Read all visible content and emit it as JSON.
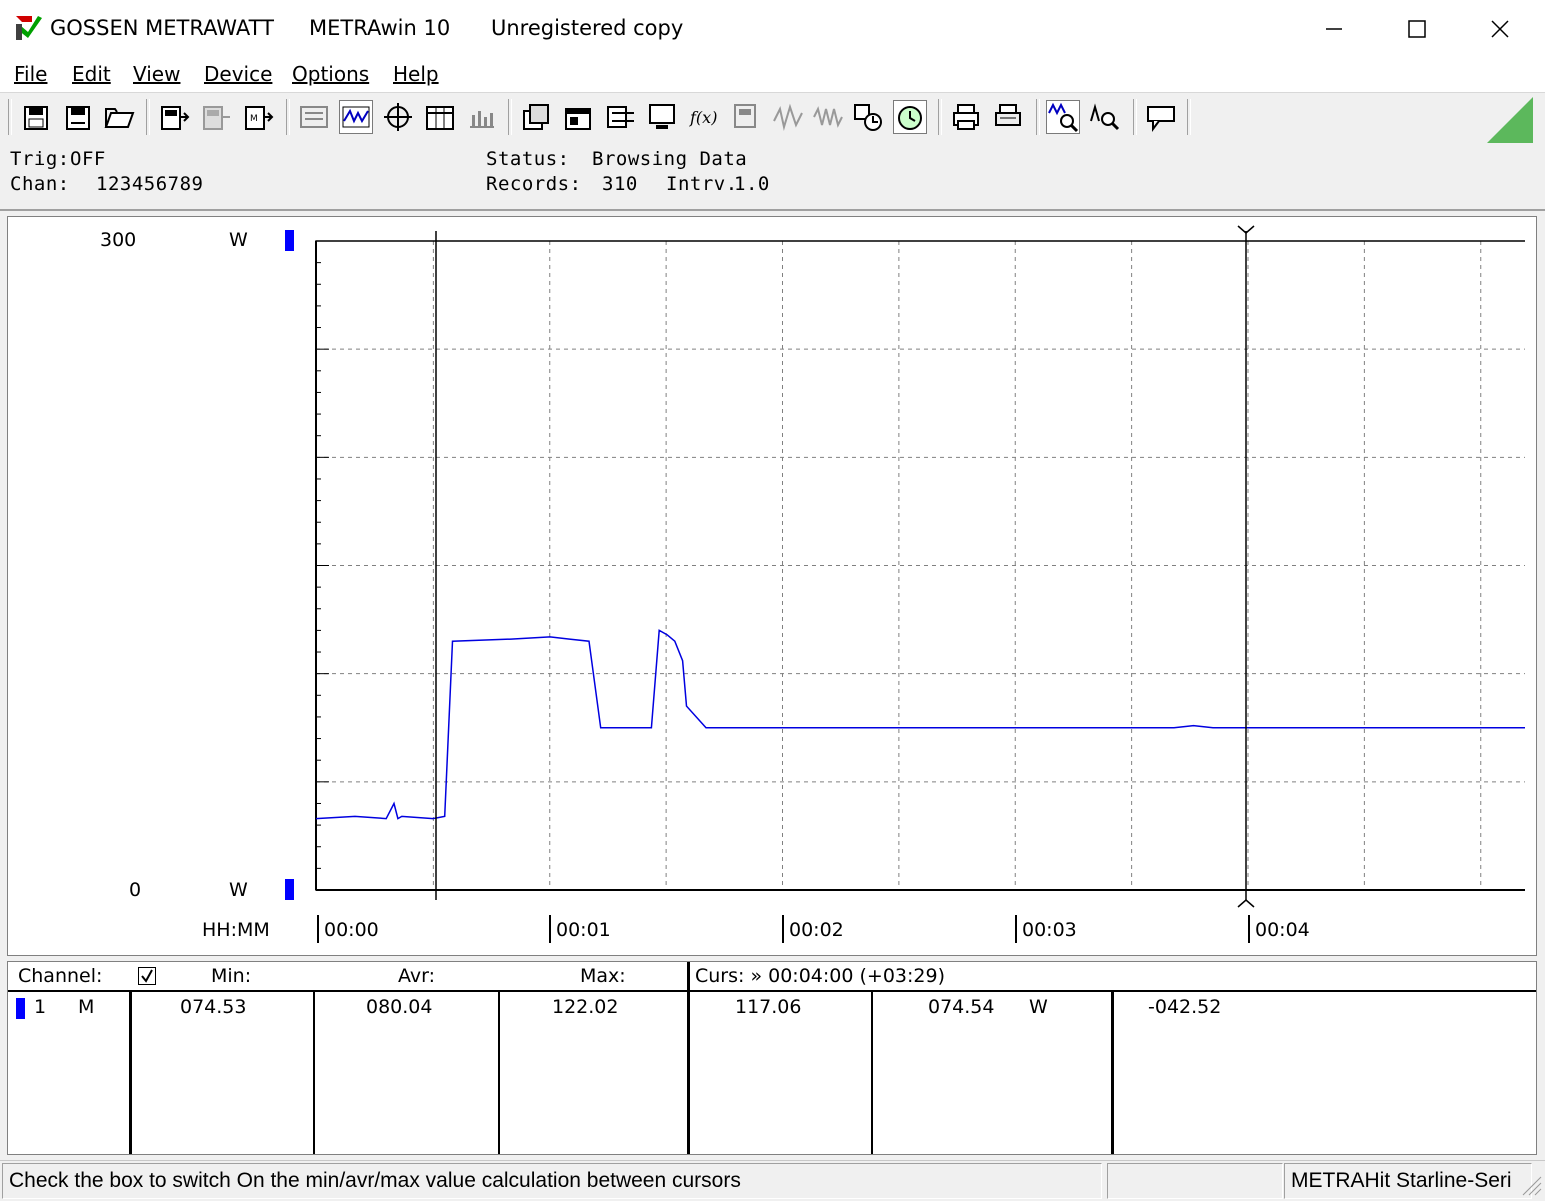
{
  "window": {
    "brand": "GOSSEN METRAWATT",
    "app_name": "METRAwin 10",
    "registration": "Unregistered copy"
  },
  "menu": [
    {
      "label": "File"
    },
    {
      "label": "Edit"
    },
    {
      "label": "View"
    },
    {
      "label": "Device"
    },
    {
      "label": "Options"
    },
    {
      "label": "Help"
    }
  ],
  "toolbar": {
    "icons": [
      "save-icon",
      "save-as-icon",
      "open-icon",
      "device-read-icon",
      "device-memory-icon",
      "device-meter-icon",
      "list-view-icon",
      "trend-view-icon",
      "scope-view-icon",
      "table-view-icon",
      "histogram-icon",
      "channel-config-icon",
      "multi-window-icon",
      "bargraph-icon",
      "monitor-icon",
      "function-icon",
      "record-icon",
      "waveform-icon",
      "multi-waveform-icon",
      "settings-icon",
      "clock-icon",
      "print-icon",
      "print-preview-icon",
      "zoom-icon",
      "search-icon",
      "message-icon"
    ],
    "pressed": [
      "trend-view-icon",
      "clock-icon",
      "zoom-icon"
    ]
  },
  "status": {
    "trig_label": "Trig:",
    "trig_value": "OFF",
    "chan_label": "Chan:",
    "chan_value": "123456789",
    "status_label": "Status:",
    "status_value": "Browsing Data",
    "records_label": "Records:",
    "records_value": "310",
    "interval_label": "Intrv.",
    "interval_value": "1.0"
  },
  "chart": {
    "y_top_value": "300",
    "y_top_unit": "W",
    "y_bottom_value": "0",
    "y_bottom_unit": "W",
    "x_axis_label": "HH:MM",
    "x_ticks": [
      "00:00",
      "00:01",
      "00:02",
      "00:03",
      "00:04"
    ],
    "line_color": "#0000e0",
    "cursor_color": "#000000"
  },
  "chart_data": {
    "type": "line",
    "xlabel": "HH:MM",
    "ylabel": "W",
    "ylim": [
      0,
      300
    ],
    "xlim": [
      0,
      310
    ],
    "grid": true,
    "series": [
      {
        "values_x": [
          0,
          10,
          18,
          20,
          21,
          22,
          30,
          33,
          35,
          50,
          60,
          65,
          70,
          73,
          75,
          78,
          80,
          81,
          84,
          85,
          86,
          88,
          90,
          92,
          94,
          95,
          100,
          115,
          120,
          125,
          140,
          150,
          160,
          180,
          200,
          220,
          225,
          230,
          250,
          260,
          270,
          300,
          310
        ],
        "values_y": [
          33,
          34,
          33,
          40,
          33,
          34,
          33,
          34,
          115,
          116,
          117,
          116,
          115,
          75,
          75,
          75,
          75,
          75,
          75,
          75,
          75,
          120,
          118,
          115,
          106,
          85,
          75,
          75,
          75,
          75,
          75,
          75,
          75,
          75,
          75,
          75,
          76,
          75,
          75,
          75,
          75,
          75,
          75
        ]
      }
    ]
  },
  "table": {
    "headers": {
      "channel": "Channel:",
      "min": "Min:",
      "avr": "Avr:",
      "max": "Max:",
      "cursor": "Curs: » 00:04:00 (+03:29)"
    },
    "checkbox_checked": true,
    "rows": [
      {
        "channel": "1",
        "mode": "M",
        "min": "074.53",
        "avr": "080.04",
        "max": "122.02",
        "cursor1": "117.06",
        "cursor2": "074.54",
        "unit": "W",
        "delta": "-042.52"
      }
    ],
    "channel_color": "#0000ff"
  },
  "statusbar": {
    "hint": "Check the box to switch On the min/avr/max value calculation between cursors",
    "middle": "",
    "device": "METRAHit Starline-Seri"
  }
}
